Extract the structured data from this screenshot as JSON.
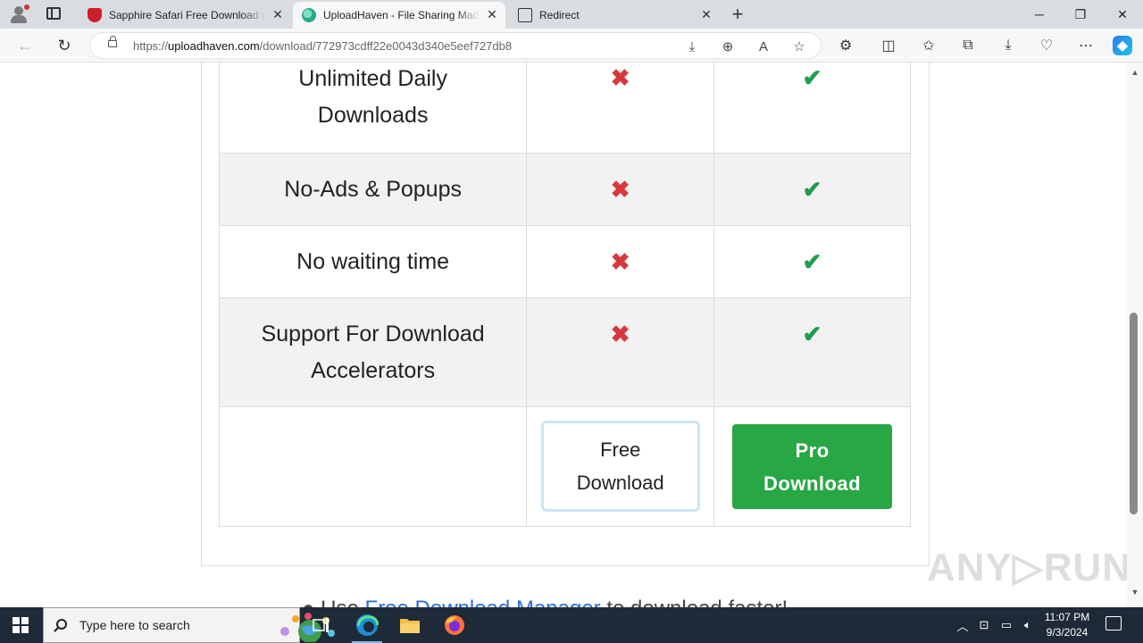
{
  "browser": {
    "tabs": [
      {
        "title": "Sapphire Safari Free Download (W",
        "icon": "sapphire-icon",
        "active": false
      },
      {
        "title": "UploadHaven - File Sharing Made",
        "icon": "uploadhaven-icon",
        "active": true
      },
      {
        "title": "Redirect",
        "icon": "document-icon",
        "active": false
      }
    ],
    "url_scheme": "https://",
    "url_host": "uploadhaven.com",
    "url_path": "/download/772973cdff22e0043d340e5eef727db8"
  },
  "comparison": {
    "rows": [
      {
        "feature": "Unlimited Daily\nDownloads",
        "free": "✖",
        "pro": "✔"
      },
      {
        "feature": "No-Ads & Popups",
        "free": "✖",
        "pro": "✔"
      },
      {
        "feature": "No waiting time",
        "free": "✖",
        "pro": "✔"
      },
      {
        "feature": "Support For Download\nAccelerators",
        "free": "✖",
        "pro": "✔"
      }
    ],
    "free_button": "Free\nDownload",
    "pro_button": "Pro\nDownload"
  },
  "cut_text": {
    "prefix": "Use ",
    "link": "Free Download Manager",
    "suffix": " to download faster!"
  },
  "watermark": "ANY▷RUN",
  "taskbar": {
    "search_placeholder": "Type here to search",
    "time": "11:07 PM",
    "date": "9/3/2024"
  },
  "colors": {
    "pro_green": "#28a745",
    "cross_red": "#d9373e",
    "check_green": "#1f9d4c"
  }
}
